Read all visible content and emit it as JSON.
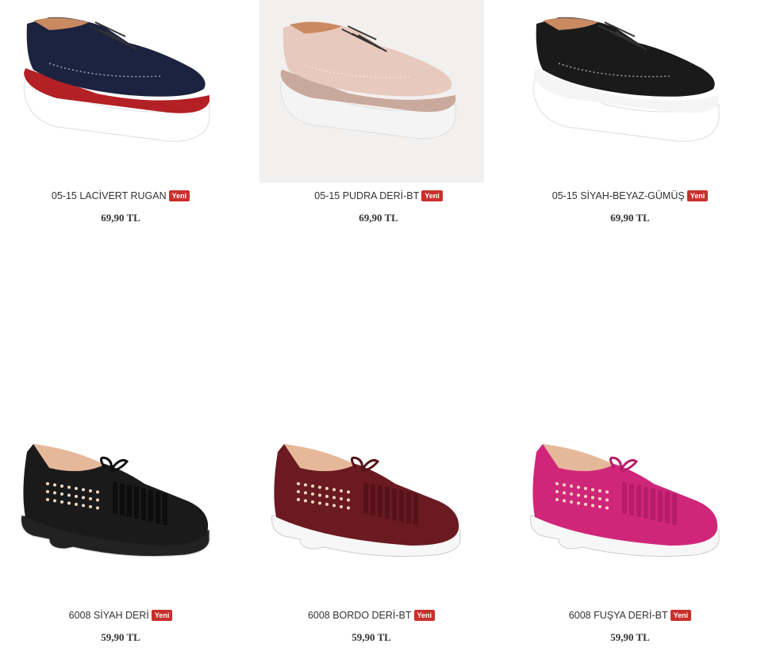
{
  "products": [
    {
      "name": "05-15 LACİVERT RUGAN",
      "badge": "Yeni",
      "price": "69,90 TL",
      "icon": "oxford-shoe-icon",
      "upper": "#1c2340",
      "accent": "#b32025",
      "sole": "#ffffff",
      "bg": "#ffffff"
    },
    {
      "name": "05-15 PUDRA DERİ-BT",
      "badge": "Yeni",
      "price": "69,90 TL",
      "icon": "oxford-shoe-icon",
      "upper": "#e8c9bd",
      "accent": "#caa99d",
      "sole": "#f4f4f4",
      "bg": "#f2f0ef"
    },
    {
      "name": "05-15 SİYAH-BEYAZ-GÜMÜŞ",
      "badge": "Yeni",
      "price": "69,90 TL",
      "icon": "oxford-shoe-icon",
      "upper": "#1a1a1a",
      "accent": "#f5f5f5",
      "sole": "#ffffff",
      "bg": "#ffffff"
    },
    {
      "name": "6008 SİYAH DERİ",
      "badge": "Yeni",
      "price": "59,90 TL",
      "icon": "loafer-shoe-icon",
      "upper": "#1a1a1a",
      "accent": "#0d0d0d",
      "sole": "#222222",
      "bg": "#ffffff"
    },
    {
      "name": "6008 BORDO DERİ-BT",
      "badge": "Yeni",
      "price": "59,90 TL",
      "icon": "loafer-shoe-icon",
      "upper": "#6b1a22",
      "accent": "#561319",
      "sole": "#f7f7f7",
      "bg": "#ffffff"
    },
    {
      "name": "6008 FUŞYA DERİ-BT",
      "badge": "Yeni",
      "price": "59,90 TL",
      "icon": "loafer-shoe-icon",
      "upper": "#d0267a",
      "accent": "#b51d68",
      "sole": "#f7f7f7",
      "bg": "#ffffff"
    }
  ]
}
